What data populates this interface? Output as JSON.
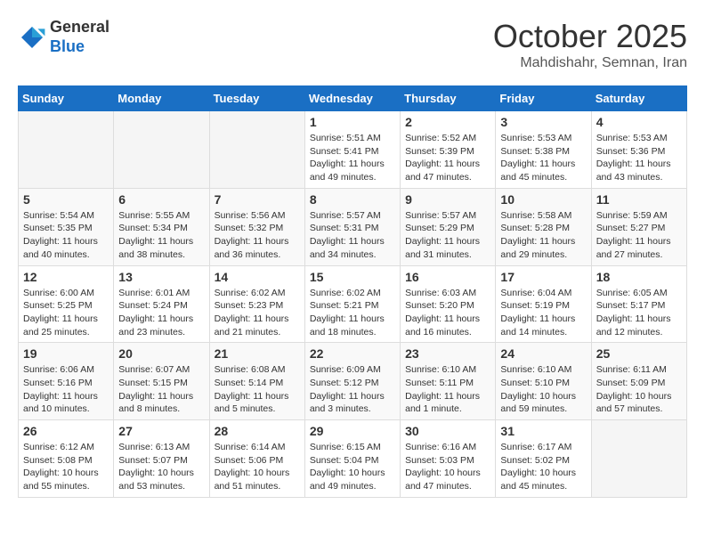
{
  "header": {
    "logo": {
      "general": "General",
      "blue": "Blue"
    },
    "month": "October 2025",
    "location": "Mahdishahr, Semnan, Iran"
  },
  "weekdays": [
    "Sunday",
    "Monday",
    "Tuesday",
    "Wednesday",
    "Thursday",
    "Friday",
    "Saturday"
  ],
  "weeks": [
    [
      {
        "day": "",
        "info": ""
      },
      {
        "day": "",
        "info": ""
      },
      {
        "day": "",
        "info": ""
      },
      {
        "day": "1",
        "info": "Sunrise: 5:51 AM\nSunset: 5:41 PM\nDaylight: 11 hours\nand 49 minutes."
      },
      {
        "day": "2",
        "info": "Sunrise: 5:52 AM\nSunset: 5:39 PM\nDaylight: 11 hours\nand 47 minutes."
      },
      {
        "day": "3",
        "info": "Sunrise: 5:53 AM\nSunset: 5:38 PM\nDaylight: 11 hours\nand 45 minutes."
      },
      {
        "day": "4",
        "info": "Sunrise: 5:53 AM\nSunset: 5:36 PM\nDaylight: 11 hours\nand 43 minutes."
      }
    ],
    [
      {
        "day": "5",
        "info": "Sunrise: 5:54 AM\nSunset: 5:35 PM\nDaylight: 11 hours\nand 40 minutes."
      },
      {
        "day": "6",
        "info": "Sunrise: 5:55 AM\nSunset: 5:34 PM\nDaylight: 11 hours\nand 38 minutes."
      },
      {
        "day": "7",
        "info": "Sunrise: 5:56 AM\nSunset: 5:32 PM\nDaylight: 11 hours\nand 36 minutes."
      },
      {
        "day": "8",
        "info": "Sunrise: 5:57 AM\nSunset: 5:31 PM\nDaylight: 11 hours\nand 34 minutes."
      },
      {
        "day": "9",
        "info": "Sunrise: 5:57 AM\nSunset: 5:29 PM\nDaylight: 11 hours\nand 31 minutes."
      },
      {
        "day": "10",
        "info": "Sunrise: 5:58 AM\nSunset: 5:28 PM\nDaylight: 11 hours\nand 29 minutes."
      },
      {
        "day": "11",
        "info": "Sunrise: 5:59 AM\nSunset: 5:27 PM\nDaylight: 11 hours\nand 27 minutes."
      }
    ],
    [
      {
        "day": "12",
        "info": "Sunrise: 6:00 AM\nSunset: 5:25 PM\nDaylight: 11 hours\nand 25 minutes."
      },
      {
        "day": "13",
        "info": "Sunrise: 6:01 AM\nSunset: 5:24 PM\nDaylight: 11 hours\nand 23 minutes."
      },
      {
        "day": "14",
        "info": "Sunrise: 6:02 AM\nSunset: 5:23 PM\nDaylight: 11 hours\nand 21 minutes."
      },
      {
        "day": "15",
        "info": "Sunrise: 6:02 AM\nSunset: 5:21 PM\nDaylight: 11 hours\nand 18 minutes."
      },
      {
        "day": "16",
        "info": "Sunrise: 6:03 AM\nSunset: 5:20 PM\nDaylight: 11 hours\nand 16 minutes."
      },
      {
        "day": "17",
        "info": "Sunrise: 6:04 AM\nSunset: 5:19 PM\nDaylight: 11 hours\nand 14 minutes."
      },
      {
        "day": "18",
        "info": "Sunrise: 6:05 AM\nSunset: 5:17 PM\nDaylight: 11 hours\nand 12 minutes."
      }
    ],
    [
      {
        "day": "19",
        "info": "Sunrise: 6:06 AM\nSunset: 5:16 PM\nDaylight: 11 hours\nand 10 minutes."
      },
      {
        "day": "20",
        "info": "Sunrise: 6:07 AM\nSunset: 5:15 PM\nDaylight: 11 hours\nand 8 minutes."
      },
      {
        "day": "21",
        "info": "Sunrise: 6:08 AM\nSunset: 5:14 PM\nDaylight: 11 hours\nand 5 minutes."
      },
      {
        "day": "22",
        "info": "Sunrise: 6:09 AM\nSunset: 5:12 PM\nDaylight: 11 hours\nand 3 minutes."
      },
      {
        "day": "23",
        "info": "Sunrise: 6:10 AM\nSunset: 5:11 PM\nDaylight: 11 hours\nand 1 minute."
      },
      {
        "day": "24",
        "info": "Sunrise: 6:10 AM\nSunset: 5:10 PM\nDaylight: 10 hours\nand 59 minutes."
      },
      {
        "day": "25",
        "info": "Sunrise: 6:11 AM\nSunset: 5:09 PM\nDaylight: 10 hours\nand 57 minutes."
      }
    ],
    [
      {
        "day": "26",
        "info": "Sunrise: 6:12 AM\nSunset: 5:08 PM\nDaylight: 10 hours\nand 55 minutes."
      },
      {
        "day": "27",
        "info": "Sunrise: 6:13 AM\nSunset: 5:07 PM\nDaylight: 10 hours\nand 53 minutes."
      },
      {
        "day": "28",
        "info": "Sunrise: 6:14 AM\nSunset: 5:06 PM\nDaylight: 10 hours\nand 51 minutes."
      },
      {
        "day": "29",
        "info": "Sunrise: 6:15 AM\nSunset: 5:04 PM\nDaylight: 10 hours\nand 49 minutes."
      },
      {
        "day": "30",
        "info": "Sunrise: 6:16 AM\nSunset: 5:03 PM\nDaylight: 10 hours\nand 47 minutes."
      },
      {
        "day": "31",
        "info": "Sunrise: 6:17 AM\nSunset: 5:02 PM\nDaylight: 10 hours\nand 45 minutes."
      },
      {
        "day": "",
        "info": ""
      }
    ]
  ]
}
